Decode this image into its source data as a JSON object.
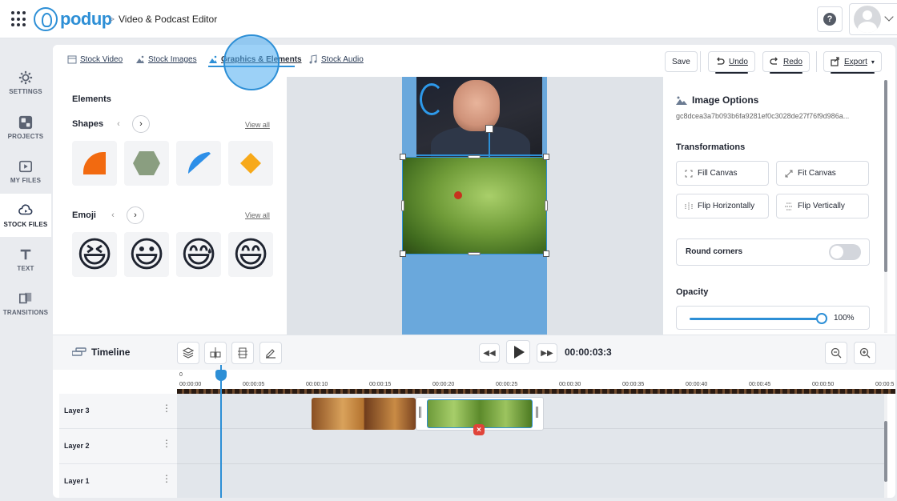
{
  "header": {
    "brand": "podup",
    "breadcrumb_sep": ">",
    "page_title": "Video & Podcast Editor",
    "help_label": "?"
  },
  "sidebar": {
    "items": [
      {
        "label": "SETTINGS",
        "icon": "gear-icon"
      },
      {
        "label": "PROJECTS",
        "icon": "projects-icon"
      },
      {
        "label": "MY FILES",
        "icon": "files-icon"
      },
      {
        "label": "STOCK FILES",
        "icon": "cloud-icon",
        "active": true
      },
      {
        "label": "TEXT",
        "icon": "text-icon"
      },
      {
        "label": "TRANSITIONS",
        "icon": "transitions-icon"
      }
    ]
  },
  "tabs": [
    {
      "label": "Stock Video"
    },
    {
      "label": "Stock Images"
    },
    {
      "label": "Graphics & Elements",
      "active": true
    },
    {
      "label": "Stock Audio"
    }
  ],
  "toolbar": {
    "save": "Save",
    "undo": "Undo",
    "redo": "Redo",
    "export": "Export"
  },
  "elements_panel": {
    "title": "Elements",
    "shapes_title": "Shapes",
    "shapes_prev": "‹",
    "shapes_next": "›",
    "shapes_view_all": "View all",
    "shapes": [
      "quarter-circle",
      "hexagon",
      "quarter-circle-blue",
      "diamond"
    ],
    "emoji_title": "Emoji",
    "emoji_prev": "‹",
    "emoji_next": "›",
    "emoji_view_all": "View all",
    "emoji": [
      "😆",
      "😃",
      "😅",
      "😄"
    ]
  },
  "image_options": {
    "title": "Image Options",
    "id": "gc8dcea3a7b093b6fa9281ef0c3028de27f76f9d986a...",
    "transformations_title": "Transformations",
    "fill_canvas": "Fill Canvas",
    "fit_canvas": "Fit Canvas",
    "flip_horizontally": "Flip Horizontally",
    "flip_vertically": "Flip Vertically",
    "round_corners": "Round corners",
    "round_corners_on": false,
    "opacity_title": "Opacity",
    "opacity_value": "100%",
    "opacity_fraction": 1.0
  },
  "timeline": {
    "title": "Timeline",
    "timecode": "00:00:03:3",
    "ruler_start": "0",
    "ruler_labels": [
      "00:00:00",
      "00:00:05",
      "00:00:10",
      "00:00:15",
      "00:00:20",
      "00:00:25",
      "00:00:30",
      "00:00:35",
      "00:00:40",
      "00:00:45",
      "00:00:50",
      "00:00:5"
    ],
    "layers": [
      {
        "name": "Layer 3"
      },
      {
        "name": "Layer 2"
      },
      {
        "name": "Layer 1"
      }
    ],
    "layer_menu": "⋮"
  },
  "colors": {
    "accent": "#2d8fd6",
    "canvas_bg": "#6aa8dc",
    "delete_red": "#e0443a"
  }
}
